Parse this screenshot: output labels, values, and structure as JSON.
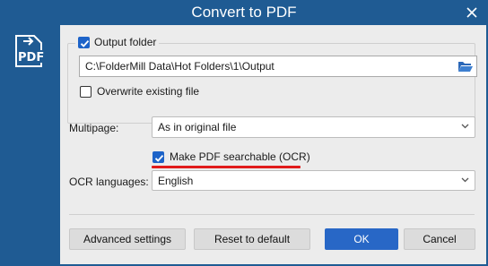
{
  "window": {
    "title": "Convert to PDF"
  },
  "icons": {
    "app": "pdf-convert-icon",
    "close": "close-icon",
    "folder": "folder-open-icon",
    "chevron": "chevron-down-icon",
    "check": "checkmark-icon"
  },
  "output": {
    "checkbox_label": "Output folder",
    "checked": true,
    "path": "C:\\FolderMill Data\\Hot Folders\\1\\Output",
    "overwrite_label": "Overwrite existing file",
    "overwrite_checked": false
  },
  "multipage": {
    "label": "Multipage:",
    "value": "As in original file"
  },
  "ocr": {
    "checkbox_label": "Make PDF searchable (OCR)",
    "checked": true,
    "languages_label": "OCR languages:",
    "languages_value": "English"
  },
  "buttons": {
    "advanced": "Advanced settings",
    "reset": "Reset to default",
    "ok": "OK",
    "cancel": "Cancel"
  },
  "colors": {
    "chrome": "#1f5b93",
    "panel": "#ececec",
    "accent": "#2867c6",
    "highlight": "#e11b1b"
  }
}
